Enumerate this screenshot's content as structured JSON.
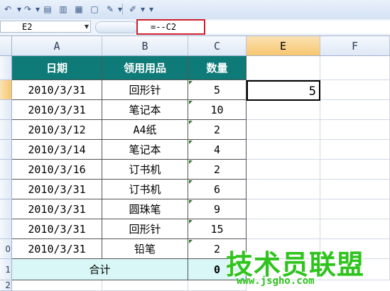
{
  "formula_bar": {
    "name_box": "E2",
    "formula": "=--C2"
  },
  "columns": [
    "A",
    "B",
    "C",
    "E",
    "F"
  ],
  "row_numbers": [
    "",
    "",
    "",
    "",
    "",
    "",
    "",
    "",
    "",
    "0",
    "1",
    "2"
  ],
  "table": {
    "headers": [
      "日期",
      "领用用品",
      "数量"
    ],
    "rows": [
      [
        "2010/3/31",
        "回形针",
        "5"
      ],
      [
        "2010/3/31",
        "笔记本",
        "10"
      ],
      [
        "2010/3/12",
        "A4纸",
        "2"
      ],
      [
        "2010/3/14",
        "笔记本",
        "4"
      ],
      [
        "2010/3/16",
        "订书机",
        "2"
      ],
      [
        "2010/3/31",
        "订书机",
        "6"
      ],
      [
        "2010/3/31",
        "圆珠笔",
        "9"
      ],
      [
        "2010/3/31",
        "回形针",
        "15"
      ],
      [
        "2010/3/31",
        "铅笔",
        "2"
      ]
    ],
    "total_label": "合计",
    "total_value": "0"
  },
  "active_cell": {
    "address": "E2",
    "value": "5"
  },
  "watermark": {
    "text": "技术员联盟",
    "url": "www.jsgho.com"
  },
  "icons": [
    "undo-icon",
    "redo-icon",
    "form-icon",
    "chart-icon",
    "table-icon",
    "new-icon",
    "tools-icon",
    "edit-icon",
    "more-icon"
  ]
}
